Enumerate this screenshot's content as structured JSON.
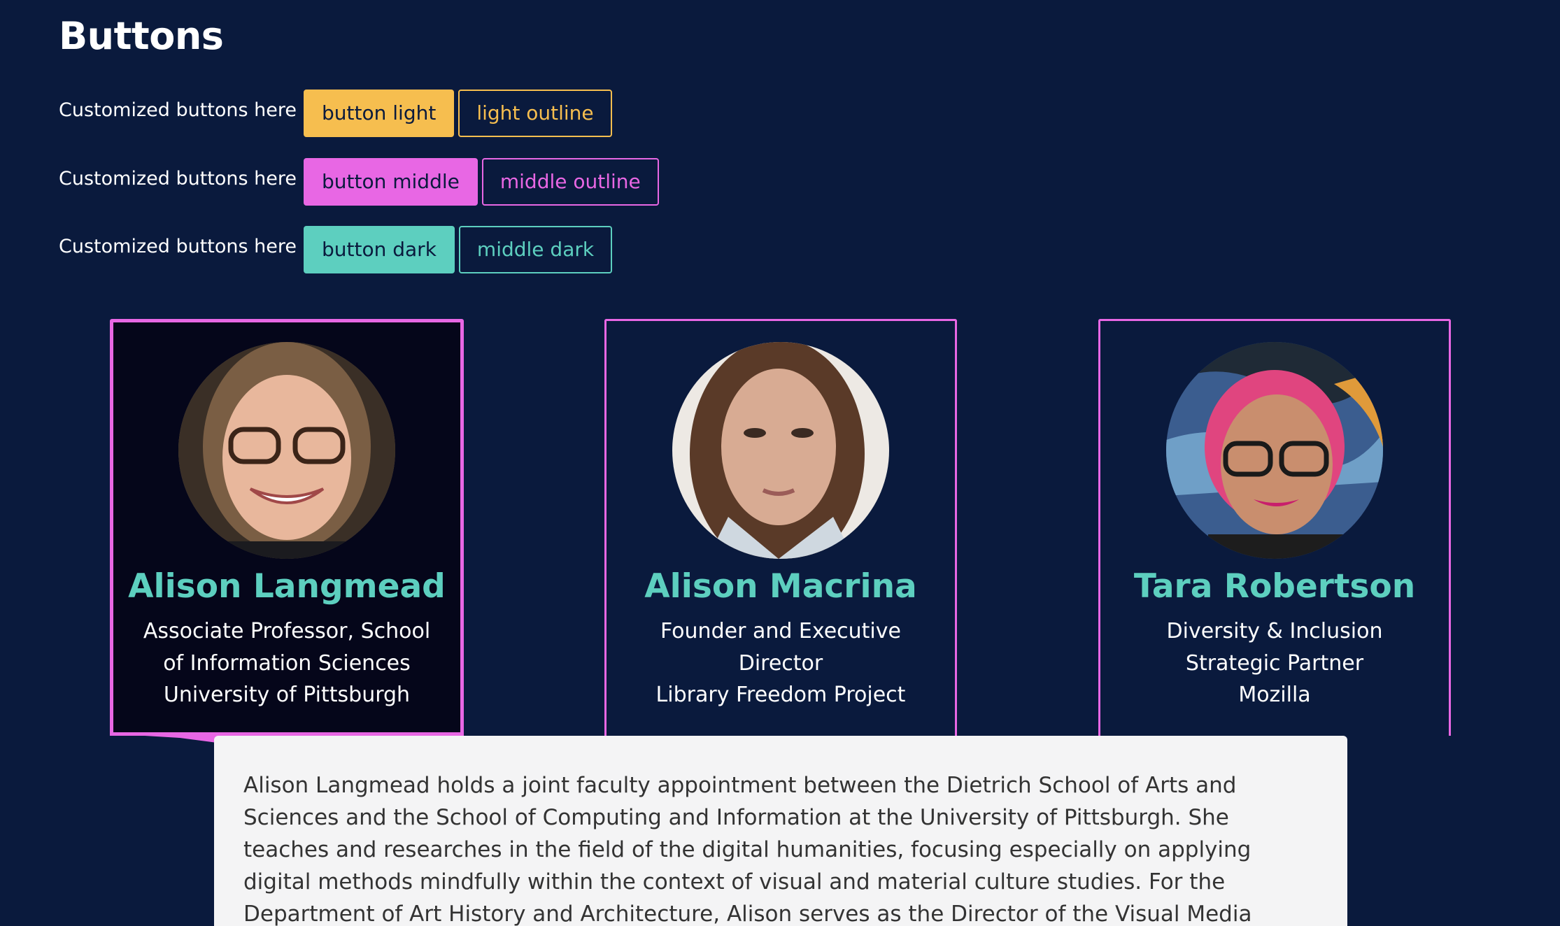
{
  "section_title": "Buttons",
  "button_rows": [
    {
      "label": "Customized buttons here",
      "solid": "button light",
      "outline": "light outline"
    },
    {
      "label": "Customized buttons here",
      "solid": "button middle",
      "outline": "middle outline"
    },
    {
      "label": "Customized buttons here",
      "solid": "button dark",
      "outline": "middle dark"
    }
  ],
  "colors": {
    "background": "#0a1a3d",
    "light": "#f6be4f",
    "middle": "#e867e4",
    "dark": "#5dcfbf",
    "panel": "#f4f4f5"
  },
  "speakers": [
    {
      "name": "Alison Langmead",
      "role": "Associate Professor, School of Information Sciences",
      "org": "University of Pittsburgh",
      "photo": "speaker-photo"
    },
    {
      "name": "Alison Macrina",
      "role": "Founder and Executive Director",
      "org": "Library Freedom Project",
      "photo": "speaker-photo"
    },
    {
      "name": "Tara Robertson",
      "role": "Diversity & Inclusion Strategic Partner",
      "org": "Mozilla",
      "photo": "speaker-photo"
    }
  ],
  "bio": "Alison Langmead holds a joint faculty appointment between the Dietrich School of Arts and Sciences and the School of Computing and Information at the University of Pittsburgh. She teaches and researches in the field of the digital humanities, focusing especially on applying digital methods mindfully within the context of visual and material culture studies. For the Department of Art History and Architecture, Alison serves as the Director of the Visual Media Workshop (VMW). The mission of the VMW is to develop and encourage the creation of innovative"
}
